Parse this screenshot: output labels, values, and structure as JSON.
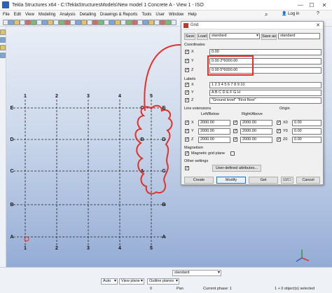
{
  "window": {
    "title": "Tekla Structures x64 - C:\\TeklaStructuresModels\\New model 1 Concrete A - View 1 - ISO",
    "minimize": "—",
    "maximize": "☐",
    "close": "✕"
  },
  "menu": {
    "items": [
      "File",
      "Edit",
      "View",
      "Modeling",
      "Analysis",
      "Detailing",
      "Drawings & Reports",
      "Tools",
      "User",
      "Window",
      "Help"
    ],
    "login": "Log in",
    "help": "?"
  },
  "grid": {
    "top_labels": [
      "1",
      "2",
      "3",
      "4",
      "5"
    ],
    "bottom_labels": [
      "1",
      "2",
      "3",
      "4",
      "5"
    ],
    "left_labels": [
      "E",
      "D",
      "C",
      "B",
      "A"
    ],
    "inner_col5_labels": [
      "C",
      "B",
      "A"
    ],
    "inner_col_right_labels": [
      "E",
      "D",
      "C",
      "B",
      "A"
    ],
    "annotation_color": "#e0312a"
  },
  "dialog": {
    "title": "Grid",
    "save": "Save",
    "load": "Load",
    "preset": "standard",
    "save_as": "Save as",
    "save_as_name": "standard",
    "sections": {
      "coordinates": "Coordinates",
      "labels": "Labels",
      "line_extensions": "Line extensions",
      "origin": "Origin",
      "magnetism": "Magnetism",
      "other": "Other settings"
    },
    "coordinates": [
      {
        "axis": "X",
        "value": "0.00"
      },
      {
        "axis": "Y",
        "value": "0.00 2*6000.00"
      },
      {
        "axis": "Z",
        "value": "0.00 5*6000.00"
      }
    ],
    "labels": [
      {
        "axis": "X",
        "value": "1 2 3 4 5 6 7 8 9 10"
      },
      {
        "axis": "Y",
        "value": "A B C D E F G H"
      },
      {
        "axis": "Z",
        "value": "\"Ground level\" \"First floor\""
      }
    ],
    "ext_headers": {
      "left_below": "Left/Below",
      "right_above": "Right/Above"
    },
    "extensions": [
      {
        "axis": "X",
        "left": "2000.00",
        "right": "2000.00"
      },
      {
        "axis": "Y",
        "left": "2000.00",
        "right": "2000.00"
      },
      {
        "axis": "Z",
        "left": "2000.00",
        "right": "2000.00"
      }
    ],
    "origin": [
      {
        "axis": "X0",
        "value": "0.00"
      },
      {
        "axis": "Y0",
        "value": "0.00"
      },
      {
        "axis": "Z0",
        "value": "0.00"
      }
    ],
    "magnetic_label": "Magnetic grid plane",
    "user_defined": "User-defined attributes...",
    "buttons": {
      "create": "Create",
      "modify": "Modify",
      "get": "Get",
      "toggle": "☑/☐",
      "cancel": "Cancel"
    }
  },
  "bottom": {
    "selects": [
      "standard",
      "Auto",
      "View plane",
      "Outline planes"
    ],
    "status": {
      "value": "0",
      "pan": "Pan",
      "phase": "Current phase: 1",
      "selected": "1 + 0 object(s) selected"
    }
  }
}
